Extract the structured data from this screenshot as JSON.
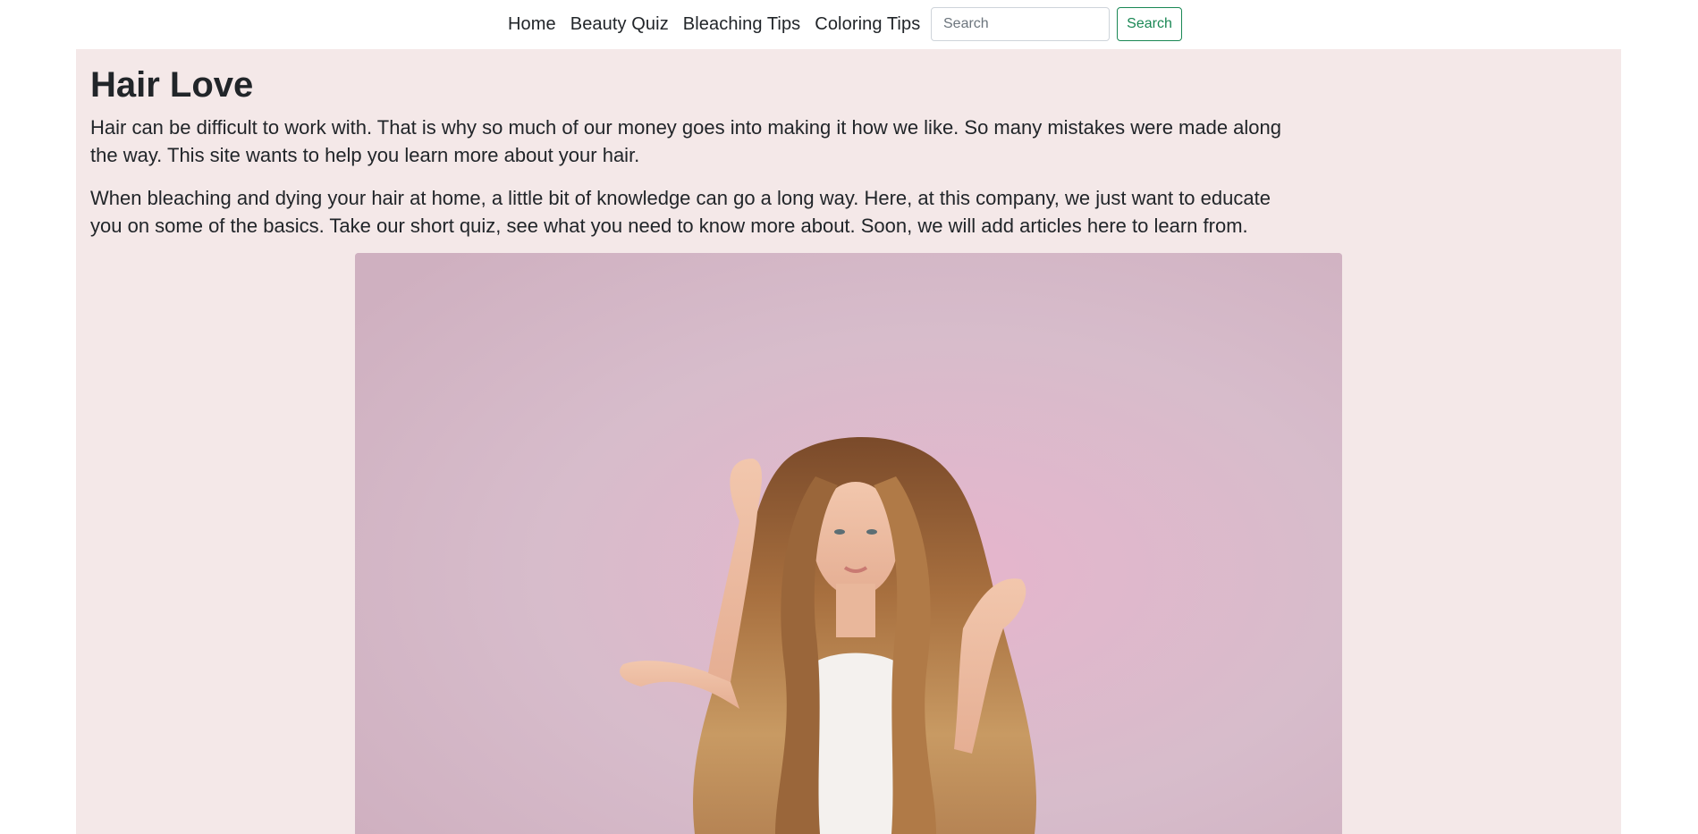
{
  "nav": {
    "links": [
      "Home",
      "Beauty Quiz",
      "Bleaching Tips",
      "Coloring Tips"
    ],
    "search_placeholder": "Search",
    "search_button_label": "Search"
  },
  "main": {
    "title": "Hair Love",
    "paragraphs": [
      "Hair can be difficult to work with. That is why so much of our money goes into making it how we like. So many mistakes were made along the way. This site wants to help you learn more about your hair.",
      "When bleaching and dying your hair at home, a little bit of knowledge can go a long way. Here, at this company, we just want to educate you on some of the basics. Take our short quiz, see what you need to know more about. Soon, we will add articles here to learn from."
    ]
  },
  "colors": {
    "page_background": "#f4e8e8",
    "accent_green": "#198754",
    "image_backdrop": "#d5b9c8"
  },
  "icons": {
    "hero_image": "woman-with-long-wavy-hair-photo"
  }
}
